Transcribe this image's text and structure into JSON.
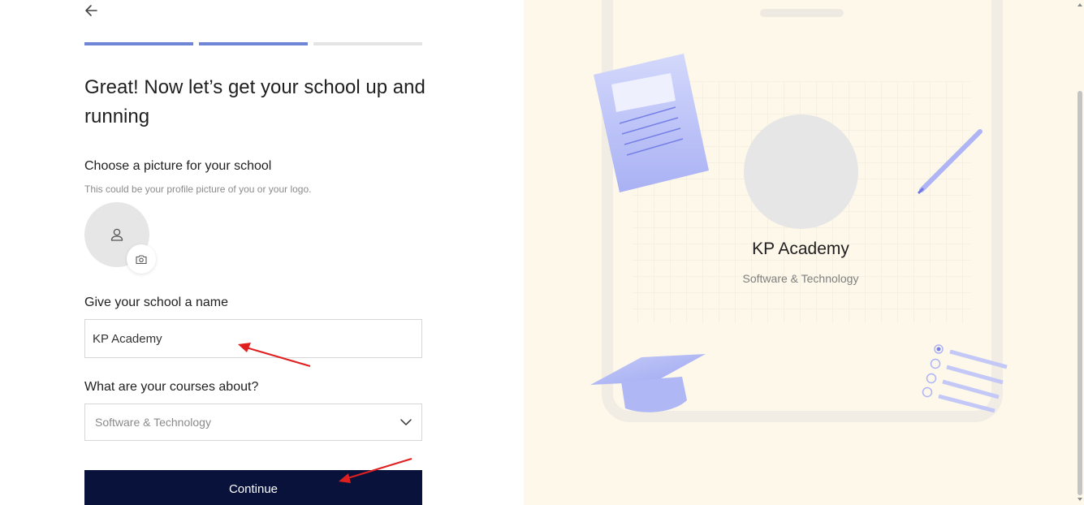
{
  "progress": {
    "total_steps": 3,
    "completed_steps": 2
  },
  "heading": "Great! Now let’s get your school up and running",
  "picture_section": {
    "label": "Choose a picture for your school",
    "hint": "This could be your profile picture of you or your logo."
  },
  "name_section": {
    "label": "Give your school a name",
    "value": "KP Academy"
  },
  "topic_section": {
    "label": "What are your courses about?",
    "selected": "Software & Technology"
  },
  "continue_label": "Continue",
  "preview": {
    "school_name": "KP Academy",
    "category": "Software & Technology"
  },
  "colors": {
    "progress_done": "#6f86d6",
    "button_bg": "#08123a",
    "preview_bg": "#fdf8ea",
    "annotation_arrow": "#e02020"
  }
}
